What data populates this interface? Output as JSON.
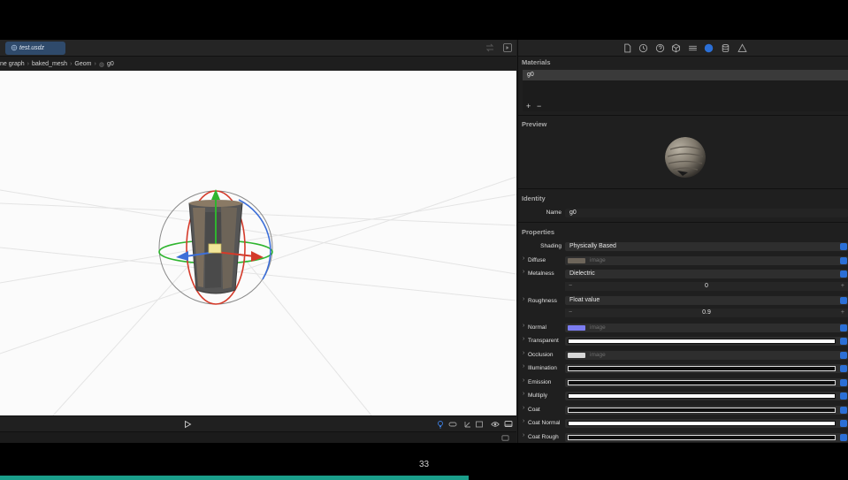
{
  "tab": {
    "title": "test.usdz"
  },
  "breadcrumb": [
    "ne graph",
    "baked_mesh",
    "Geom",
    "g0"
  ],
  "inspector": {
    "materials_title": "Materials",
    "materials": [
      "g0"
    ],
    "add_label": "+",
    "remove_label": "−",
    "preview_title": "Preview",
    "identity_title": "Identity",
    "name_label": "Name",
    "name_value": "g0",
    "properties_title": "Properties",
    "shading_label": "Shading",
    "shading_value": "Physically Based",
    "diffuse": {
      "label": "Diffuse",
      "value": "image"
    },
    "metalness": {
      "label": "Metalness",
      "value": "Dielectric",
      "number": "0"
    },
    "roughness": {
      "label": "Roughness",
      "value": "Float value",
      "number": "0.9"
    },
    "normal": {
      "label": "Normal",
      "value": "image"
    },
    "transparent": {
      "label": "Transparent"
    },
    "occlusion": {
      "label": "Occlusion",
      "value": "image"
    },
    "illumination": {
      "label": "Illumination"
    },
    "emission": {
      "label": "Emission"
    },
    "multiply": {
      "label": "Multiply"
    },
    "coat": {
      "label": "Coat"
    },
    "coat_normal": {
      "label": "Coat Normal"
    },
    "coat_rough": {
      "label": "Coat Rough"
    },
    "stepper_minus": "−",
    "stepper_plus": "+"
  },
  "page_number": "33",
  "progress": 0.553,
  "colors": {
    "accent": "#2b6fd6",
    "tab": "#2f4a6b",
    "progress": "#1a9e8a"
  }
}
